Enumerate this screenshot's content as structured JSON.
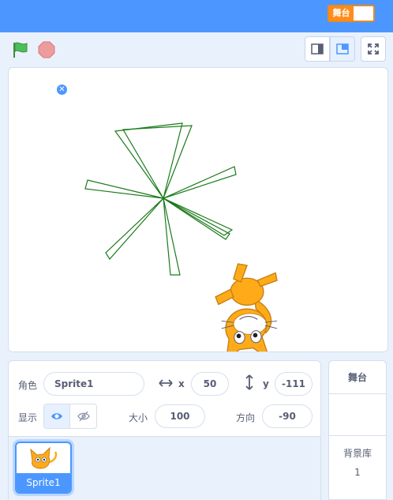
{
  "header": {
    "stage_toggle_label": "舞台"
  },
  "controls": {
    "flag_icon": "green-flag-icon",
    "stop_icon": "stop-icon"
  },
  "sprite_info": {
    "sprite_label": "角色",
    "sprite_name": "Sprite1",
    "x_label": "x",
    "x_value": "50",
    "y_label": "y",
    "y_value": "-111",
    "show_label": "显示",
    "size_label": "大小",
    "size_value": "100",
    "direction_label": "方向",
    "direction_value": "-90"
  },
  "sprites": [
    {
      "name": "Sprite1",
      "selected": true
    }
  ],
  "stage_panel": {
    "title": "舞台",
    "backdrops_label": "背景库",
    "backdrops_count": "1"
  },
  "colors": {
    "accent": "#4c97ff",
    "pen": "#1a7a1a",
    "toggle": "#ff8c1a"
  }
}
